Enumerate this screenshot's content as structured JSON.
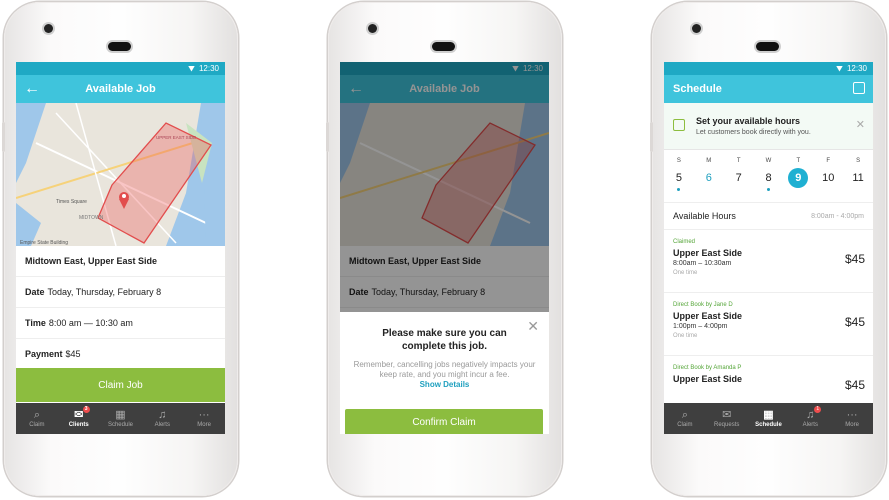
{
  "status": {
    "time": "12:30"
  },
  "phone1": {
    "title": "Available Job",
    "map_labels": {
      "upper_east_side": "UPPER EAST SIDE",
      "times_square": "Times Square",
      "empire": "Empire State Building",
      "midtown": "MIDTOWN"
    },
    "location": "Midtown East, Upper East Side",
    "date_label": "Date",
    "date_value": "Today, Thursday, February 8",
    "time_label": "Time",
    "time_value": "8:00 am — 10:30 am",
    "payment_label": "Payment",
    "payment_value": "$45",
    "claim_button": "Claim Job"
  },
  "phone2": {
    "title": "Available Job",
    "location": "Midtown East, Upper East Side",
    "date_label": "Date",
    "date_value": "Today, Thursday, February 8",
    "dialog_title": "Please make sure you can complete this job.",
    "dialog_body": "Remember, cancelling jobs negatively impacts your keep rate, and you might incur a fee.",
    "show_details": "Show Details",
    "confirm_button": "Confirm Claim"
  },
  "phone3": {
    "title": "Schedule",
    "banner_title": "Set your available hours",
    "banner_subtitle": "Let customers book directly with you.",
    "weekdays": [
      "S",
      "M",
      "T",
      "W",
      "T",
      "F",
      "S"
    ],
    "days": [
      "5",
      "6",
      "7",
      "8",
      "9",
      "10",
      "11"
    ],
    "available_label": "Available Hours",
    "available_value": "8:00am - 4:00pm",
    "jobs": [
      {
        "tag": "Claimed",
        "location": "Upper East Side",
        "time": "8:00am – 10:30am",
        "freq": "One time",
        "price": "$45"
      },
      {
        "tag": "Direct Book by Jane D",
        "location": "Upper East Side",
        "time": "1:00pm – 4:00pm",
        "freq": "One time",
        "price": "$45"
      },
      {
        "tag": "Direct Book by Amanda P",
        "location": "Upper East Side",
        "time": "",
        "freq": "",
        "price": "$45"
      }
    ]
  },
  "tabs_a": [
    {
      "label": "Claim",
      "icon": "search-icon"
    },
    {
      "label": "Clients",
      "icon": "envelope-icon",
      "badge": "3"
    },
    {
      "label": "Schedule",
      "icon": "calendar-icon"
    },
    {
      "label": "Alerts",
      "icon": "bell-icon"
    },
    {
      "label": "More",
      "icon": "more-icon"
    }
  ],
  "tabs_b": [
    {
      "label": "Claim",
      "icon": "search-icon"
    },
    {
      "label": "Requests",
      "icon": "envelope-icon"
    },
    {
      "label": "Schedule",
      "icon": "calendar-icon"
    },
    {
      "label": "Alerts",
      "icon": "bell-icon",
      "badge": "1"
    },
    {
      "label": "More",
      "icon": "more-icon"
    }
  ],
  "colors": {
    "teal": "#3fc4dc",
    "green": "#8cbd3f",
    "tabbar": "#3f3f3f"
  }
}
